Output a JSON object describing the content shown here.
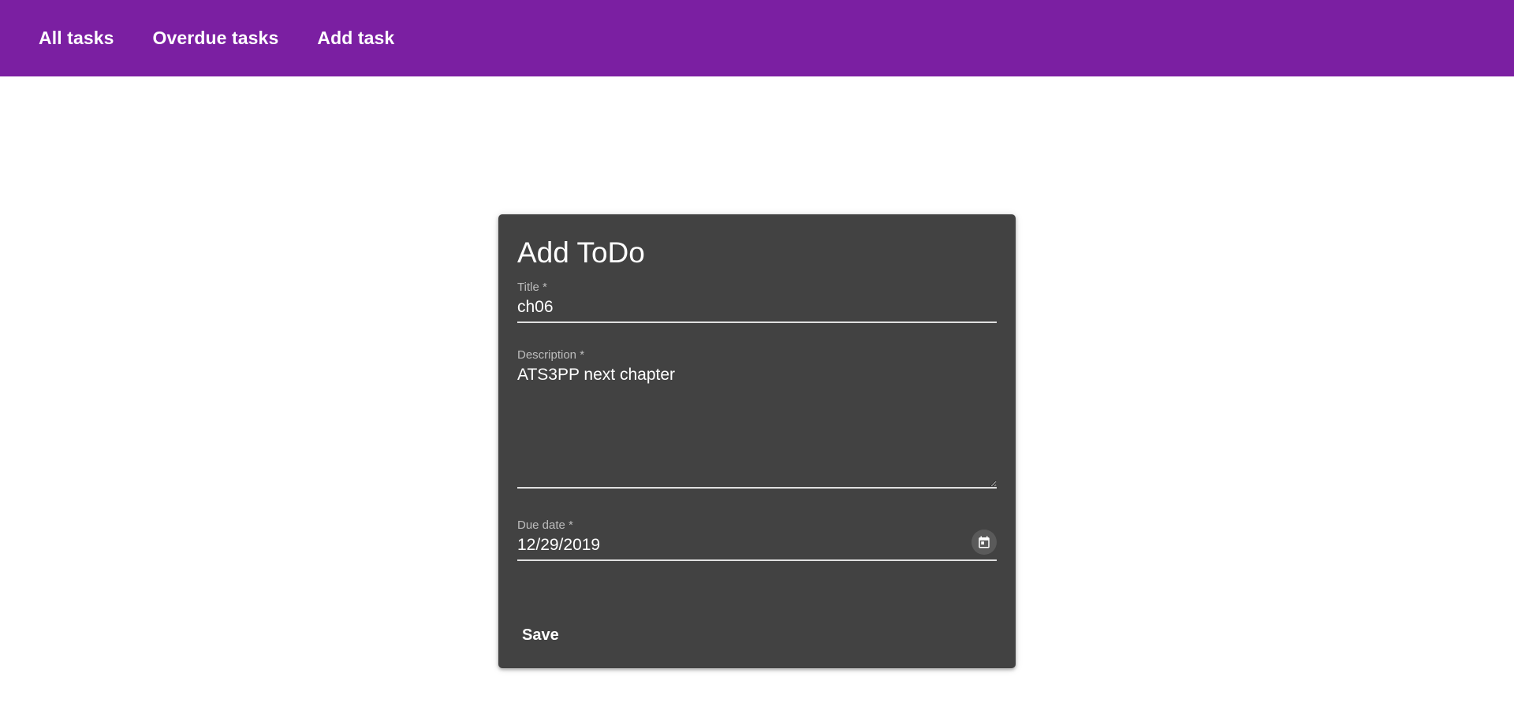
{
  "nav": {
    "items": [
      {
        "label": "All tasks"
      },
      {
        "label": "Overdue tasks"
      },
      {
        "label": "Add task"
      }
    ]
  },
  "form": {
    "title": "Add ToDo",
    "fields": {
      "title": {
        "label": "Title *",
        "value": "ch06"
      },
      "description": {
        "label": "Description *",
        "value": "ATS3PP next chapter"
      },
      "due_date": {
        "label": "Due date *",
        "value": "12/29/2019",
        "icon": "calendar-icon"
      }
    },
    "save_label": "Save"
  },
  "colors": {
    "nav_background": "#7b1fa2",
    "card_background": "#424242",
    "text": "#ffffff"
  }
}
